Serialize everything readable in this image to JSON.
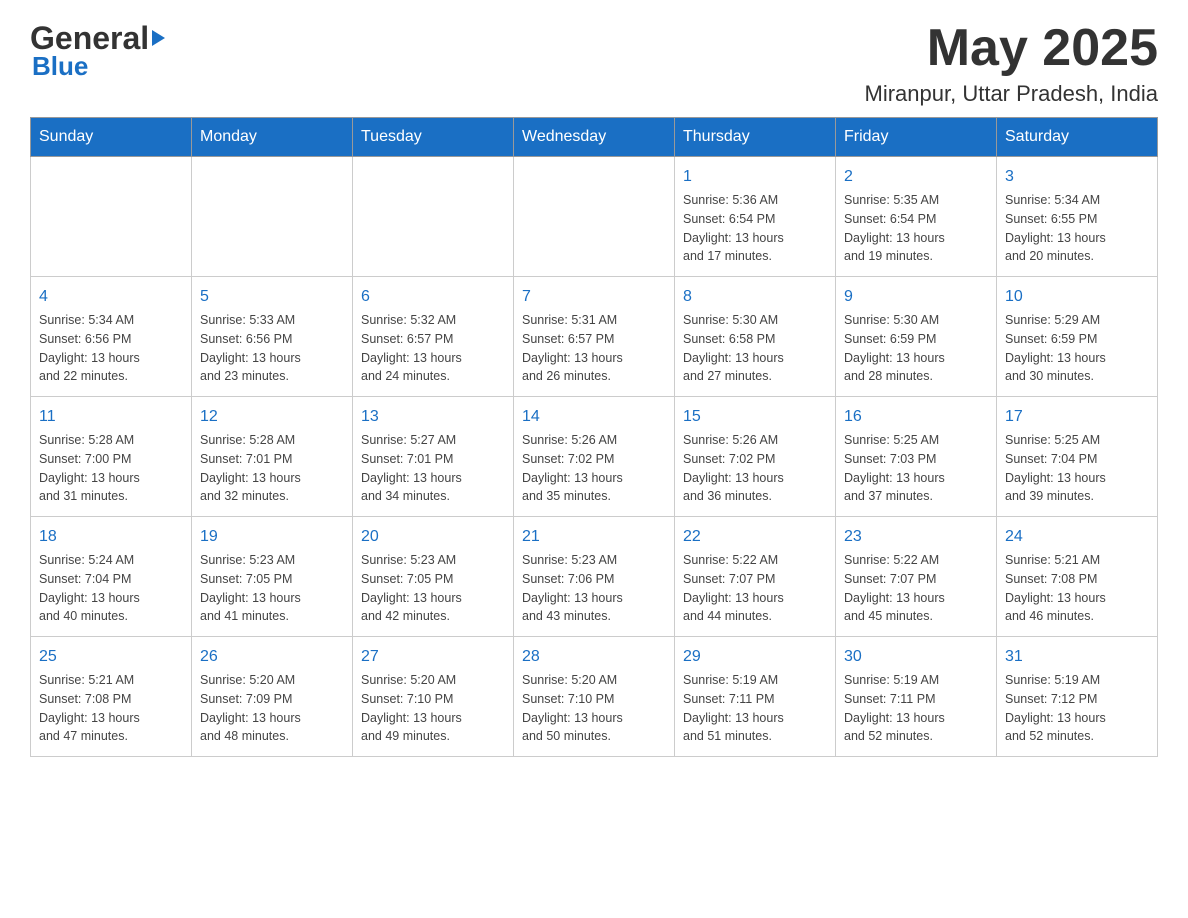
{
  "header": {
    "logo_general": "General",
    "logo_blue": "Blue",
    "month_year": "May 2025",
    "location": "Miranpur, Uttar Pradesh, India"
  },
  "days_of_week": [
    "Sunday",
    "Monday",
    "Tuesday",
    "Wednesday",
    "Thursday",
    "Friday",
    "Saturday"
  ],
  "weeks": [
    [
      {
        "num": "",
        "info": ""
      },
      {
        "num": "",
        "info": ""
      },
      {
        "num": "",
        "info": ""
      },
      {
        "num": "",
        "info": ""
      },
      {
        "num": "1",
        "info": "Sunrise: 5:36 AM\nSunset: 6:54 PM\nDaylight: 13 hours\nand 17 minutes."
      },
      {
        "num": "2",
        "info": "Sunrise: 5:35 AM\nSunset: 6:54 PM\nDaylight: 13 hours\nand 19 minutes."
      },
      {
        "num": "3",
        "info": "Sunrise: 5:34 AM\nSunset: 6:55 PM\nDaylight: 13 hours\nand 20 minutes."
      }
    ],
    [
      {
        "num": "4",
        "info": "Sunrise: 5:34 AM\nSunset: 6:56 PM\nDaylight: 13 hours\nand 22 minutes."
      },
      {
        "num": "5",
        "info": "Sunrise: 5:33 AM\nSunset: 6:56 PM\nDaylight: 13 hours\nand 23 minutes."
      },
      {
        "num": "6",
        "info": "Sunrise: 5:32 AM\nSunset: 6:57 PM\nDaylight: 13 hours\nand 24 minutes."
      },
      {
        "num": "7",
        "info": "Sunrise: 5:31 AM\nSunset: 6:57 PM\nDaylight: 13 hours\nand 26 minutes."
      },
      {
        "num": "8",
        "info": "Sunrise: 5:30 AM\nSunset: 6:58 PM\nDaylight: 13 hours\nand 27 minutes."
      },
      {
        "num": "9",
        "info": "Sunrise: 5:30 AM\nSunset: 6:59 PM\nDaylight: 13 hours\nand 28 minutes."
      },
      {
        "num": "10",
        "info": "Sunrise: 5:29 AM\nSunset: 6:59 PM\nDaylight: 13 hours\nand 30 minutes."
      }
    ],
    [
      {
        "num": "11",
        "info": "Sunrise: 5:28 AM\nSunset: 7:00 PM\nDaylight: 13 hours\nand 31 minutes."
      },
      {
        "num": "12",
        "info": "Sunrise: 5:28 AM\nSunset: 7:01 PM\nDaylight: 13 hours\nand 32 minutes."
      },
      {
        "num": "13",
        "info": "Sunrise: 5:27 AM\nSunset: 7:01 PM\nDaylight: 13 hours\nand 34 minutes."
      },
      {
        "num": "14",
        "info": "Sunrise: 5:26 AM\nSunset: 7:02 PM\nDaylight: 13 hours\nand 35 minutes."
      },
      {
        "num": "15",
        "info": "Sunrise: 5:26 AM\nSunset: 7:02 PM\nDaylight: 13 hours\nand 36 minutes."
      },
      {
        "num": "16",
        "info": "Sunrise: 5:25 AM\nSunset: 7:03 PM\nDaylight: 13 hours\nand 37 minutes."
      },
      {
        "num": "17",
        "info": "Sunrise: 5:25 AM\nSunset: 7:04 PM\nDaylight: 13 hours\nand 39 minutes."
      }
    ],
    [
      {
        "num": "18",
        "info": "Sunrise: 5:24 AM\nSunset: 7:04 PM\nDaylight: 13 hours\nand 40 minutes."
      },
      {
        "num": "19",
        "info": "Sunrise: 5:23 AM\nSunset: 7:05 PM\nDaylight: 13 hours\nand 41 minutes."
      },
      {
        "num": "20",
        "info": "Sunrise: 5:23 AM\nSunset: 7:05 PM\nDaylight: 13 hours\nand 42 minutes."
      },
      {
        "num": "21",
        "info": "Sunrise: 5:23 AM\nSunset: 7:06 PM\nDaylight: 13 hours\nand 43 minutes."
      },
      {
        "num": "22",
        "info": "Sunrise: 5:22 AM\nSunset: 7:07 PM\nDaylight: 13 hours\nand 44 minutes."
      },
      {
        "num": "23",
        "info": "Sunrise: 5:22 AM\nSunset: 7:07 PM\nDaylight: 13 hours\nand 45 minutes."
      },
      {
        "num": "24",
        "info": "Sunrise: 5:21 AM\nSunset: 7:08 PM\nDaylight: 13 hours\nand 46 minutes."
      }
    ],
    [
      {
        "num": "25",
        "info": "Sunrise: 5:21 AM\nSunset: 7:08 PM\nDaylight: 13 hours\nand 47 minutes."
      },
      {
        "num": "26",
        "info": "Sunrise: 5:20 AM\nSunset: 7:09 PM\nDaylight: 13 hours\nand 48 minutes."
      },
      {
        "num": "27",
        "info": "Sunrise: 5:20 AM\nSunset: 7:10 PM\nDaylight: 13 hours\nand 49 minutes."
      },
      {
        "num": "28",
        "info": "Sunrise: 5:20 AM\nSunset: 7:10 PM\nDaylight: 13 hours\nand 50 minutes."
      },
      {
        "num": "29",
        "info": "Sunrise: 5:19 AM\nSunset: 7:11 PM\nDaylight: 13 hours\nand 51 minutes."
      },
      {
        "num": "30",
        "info": "Sunrise: 5:19 AM\nSunset: 7:11 PM\nDaylight: 13 hours\nand 52 minutes."
      },
      {
        "num": "31",
        "info": "Sunrise: 5:19 AM\nSunset: 7:12 PM\nDaylight: 13 hours\nand 52 minutes."
      }
    ]
  ]
}
